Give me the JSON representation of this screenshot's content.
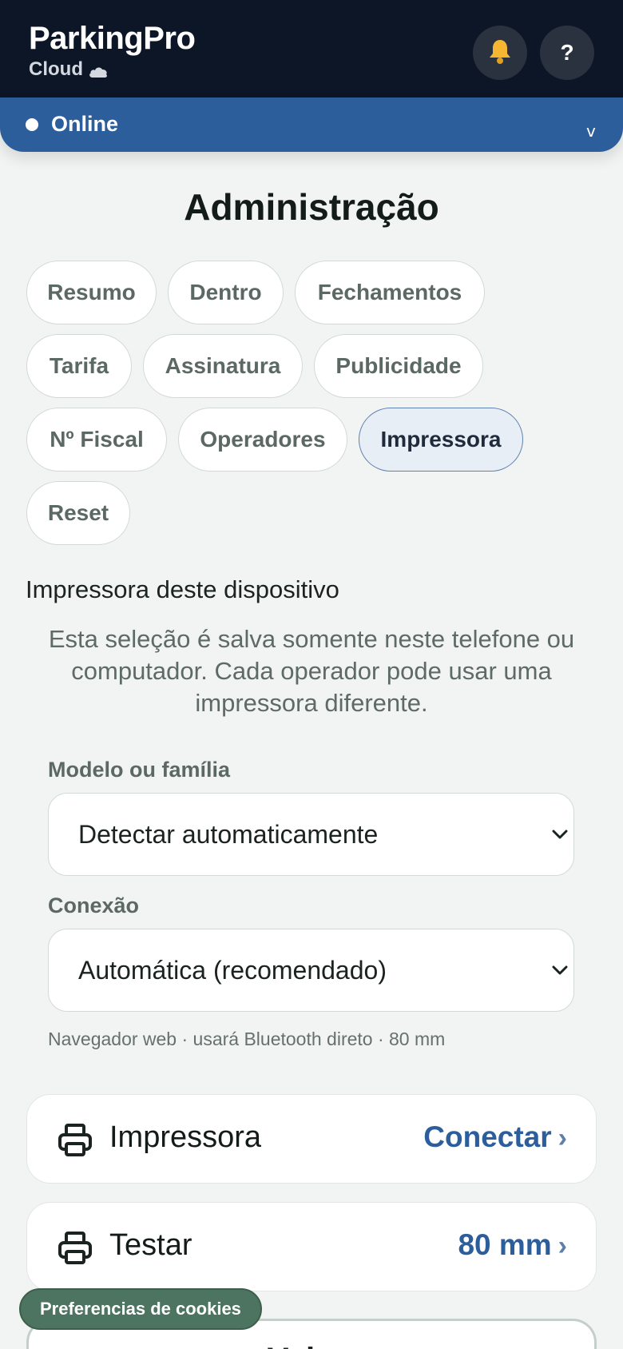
{
  "header": {
    "brand_name": "ParkingPro",
    "brand_sub": "Cloud",
    "help_label": "?",
    "bell_icon": "bell-icon",
    "cloud_icon": "cloud-icon"
  },
  "status": {
    "label": "Online",
    "chevron": "v"
  },
  "page": {
    "title": "Administração"
  },
  "tabs": [
    {
      "label": "Resumo",
      "active": false
    },
    {
      "label": "Dentro",
      "active": false
    },
    {
      "label": "Fechamentos",
      "active": false
    },
    {
      "label": "Tarifa",
      "active": false
    },
    {
      "label": "Assinatura",
      "active": false
    },
    {
      "label": "Publicidade",
      "active": false
    },
    {
      "label": "Nº Fiscal",
      "active": false
    },
    {
      "label": "Operadores",
      "active": false
    },
    {
      "label": "Impressora",
      "active": true
    },
    {
      "label": "Reset",
      "active": false
    }
  ],
  "printer_section": {
    "heading": "Impressora deste dispositivo",
    "description": "Esta seleção é salva somente neste telefone ou computador. Cada operador pode usar uma impressora diferente.",
    "model_label": "Modelo ou família",
    "model_value": "Detectar automaticamente",
    "connection_label": "Conexão",
    "connection_value": "Automática (recomendado)",
    "helper": "Navegador web · usará Bluetooth direto · 80 mm"
  },
  "cards": [
    {
      "label": "Impressora",
      "action": "Conectar",
      "arrow": "›",
      "icon": "printer-icon"
    },
    {
      "label": "Testar",
      "action": "80 mm",
      "arrow": "›",
      "icon": "printer-icon"
    }
  ],
  "partial_button": {
    "label": "Voltar"
  },
  "cookie": {
    "label": "Preferencias de cookies"
  },
  "colors": {
    "header_bg": "#0d1626",
    "status_bg": "#2c5e9c",
    "accent": "#2c5e9c",
    "cookie_bg": "#4d7460",
    "bell": "#f5b731"
  }
}
